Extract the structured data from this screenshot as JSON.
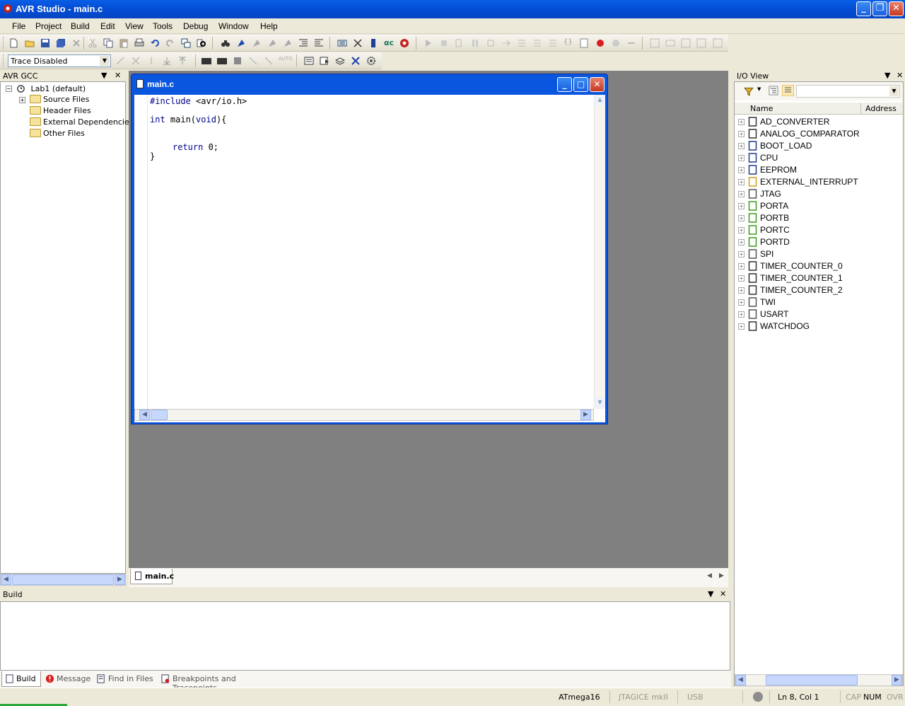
{
  "window": {
    "title": "AVR Studio - main.c"
  },
  "menu": [
    "File",
    "Project",
    "Build",
    "Edit",
    "View",
    "Tools",
    "Debug",
    "Window",
    "Help"
  ],
  "trace_toolbar": {
    "trace_select_value": "Trace Disabled"
  },
  "left_panel": {
    "title": "AVR GCC",
    "project": "Lab1 (default)",
    "folders": [
      "Source Files",
      "Header Files",
      "External Dependencies",
      "Other Files"
    ]
  },
  "editor": {
    "title": "main.c",
    "code": {
      "include_kw": "#include",
      "include_arg": " <avr/io.h>",
      "int_kw": "int",
      "main_a": " main(",
      "void_kw": "void",
      "main_b": "){",
      "return_kw": "return",
      "return_val": " 0;",
      "close_brace": "}"
    }
  },
  "doc_tab": "main.c",
  "io_view": {
    "title": "I/O View",
    "columns": {
      "name": "Name",
      "address": "Address"
    },
    "items": [
      "AD_CONVERTER",
      "ANALOG_COMPARATOR",
      "BOOT_LOAD",
      "CPU",
      "EEPROM",
      "EXTERNAL_INTERRUPT",
      "JTAG",
      "PORTA",
      "PORTB",
      "PORTC",
      "PORTD",
      "SPI",
      "TIMER_COUNTER_0",
      "TIMER_COUNTER_1",
      "TIMER_COUNTER_2",
      "TWI",
      "USART",
      "WATCHDOG"
    ]
  },
  "build_panel": {
    "title": "Build",
    "tabs": [
      "Build",
      "Message",
      "Find in Files",
      "Breakpoints and Tracepoints"
    ]
  },
  "status": {
    "device": "ATmega16",
    "tool": "JTAGICE mkII",
    "connection": "USB",
    "position": "Ln 8, Col 1",
    "cap": "CAP",
    "num": "NUM",
    "ovr": "OVR"
  },
  "colors": {
    "title_blue": "#0550d8",
    "keyword": "#00008b",
    "mdi_bg": "#808080"
  }
}
